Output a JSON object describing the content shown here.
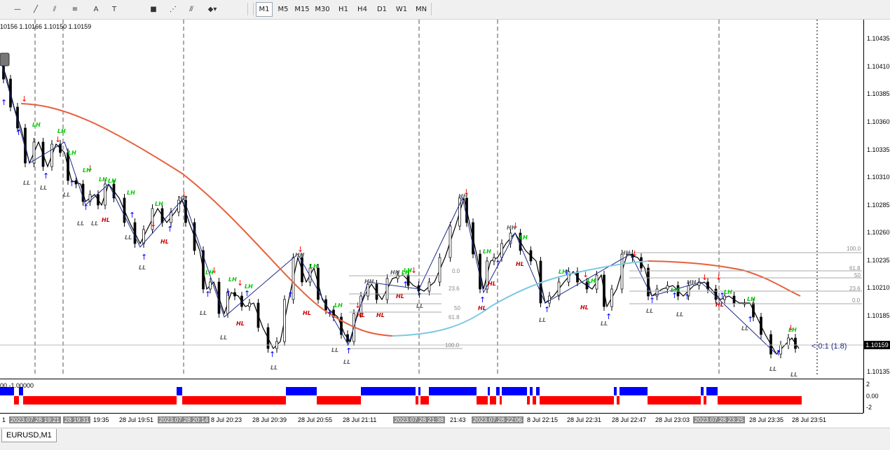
{
  "toolbar": {
    "tools": [
      {
        "name": "crosshair-icon",
        "glyph": "—"
      },
      {
        "name": "trendline-icon",
        "glyph": "╱"
      },
      {
        "name": "channel-icon",
        "glyph": "⫽"
      },
      {
        "name": "fibonacci-icon",
        "glyph": "≡"
      },
      {
        "name": "text-icon",
        "glyph": "A"
      },
      {
        "name": "textlabel-icon",
        "glyph": "T"
      },
      {
        "name": "rectangle-icon",
        "glyph": "■"
      },
      {
        "name": "fan-icon",
        "glyph": "⋰"
      },
      {
        "name": "gann-icon",
        "glyph": "⫻"
      },
      {
        "name": "arrows-icon",
        "glyph": "◆▾"
      }
    ],
    "timeframes": [
      "M1",
      "M5",
      "M15",
      "M30",
      "H1",
      "H4",
      "D1",
      "W1",
      "MN"
    ],
    "active_timeframe": "M1"
  },
  "ohlc_text": "10156 1.10166 1.10150 1.10159",
  "price_axis": [
    "1.10435",
    "1.10410",
    "1.10385",
    "1.10360",
    "1.10335",
    "1.10310",
    "1.10285",
    "1.10260",
    "1.10235",
    "1.10210",
    "1.10185",
    "1.10159",
    "1.10135"
  ],
  "current_price": "1.10159",
  "annotation": "<:0:1 (1.8)",
  "fib_labels_left": [
    "0.0",
    "23.6",
    "50",
    "61.8",
    "100.0"
  ],
  "fib_labels_right": [
    "100.0",
    "61.8",
    "50",
    "23.6",
    "0.0"
  ],
  "indicator": {
    "label": "00 -1.00000",
    "axis": [
      "2",
      "0.00",
      "-2"
    ]
  },
  "time_axis": [
    {
      "t": "1",
      "hl": false
    },
    {
      "t": "2023.07.28 19:21",
      "hl": true
    },
    {
      "t": "28 19:31",
      "hl": true
    },
    {
      "t": "19:35",
      "hl": false
    },
    {
      "t": "28 Jul 19:51",
      "hl": false
    },
    {
      "t": "2023.07.28 20:14",
      "hl": true
    },
    {
      "t": "8 Jul 20:23",
      "hl": false
    },
    {
      "t": "28 Jul 20:39",
      "hl": false
    },
    {
      "t": "28 Jul 20:55",
      "hl": false
    },
    {
      "t": "28 Jul 21:11",
      "hl": false
    },
    {
      "t": "2023.07.28 21:38",
      "hl": true
    },
    {
      "t": "21:43",
      "hl": false
    },
    {
      "t": "2023.07.28 22:06",
      "hl": true
    },
    {
      "t": "8 Jul 22:15",
      "hl": false
    },
    {
      "t": "28 Jul 22:31",
      "hl": false
    },
    {
      "t": "28 Jul 22:47",
      "hl": false
    },
    {
      "t": "28 Jul 23:03",
      "hl": false
    },
    {
      "t": "2023.07.28 23:25",
      "hl": true
    },
    {
      "t": "28 Jul 23:35",
      "hl": false
    },
    {
      "t": "28 Jul 23:51",
      "hl": false
    }
  ],
  "chart_tab": "EURUSD,M1",
  "swing_labels": {
    "ll": "LL",
    "lh": "LH",
    "hh": "HH",
    "hl": "HL"
  },
  "colors": {
    "ma_red": "#e8603c",
    "ma_blue": "#7ec8e3",
    "up": "#0000ff",
    "down": "#ff0000",
    "lh": "#00cc00",
    "hl": "#cc0000",
    "ll": "#666666"
  }
}
